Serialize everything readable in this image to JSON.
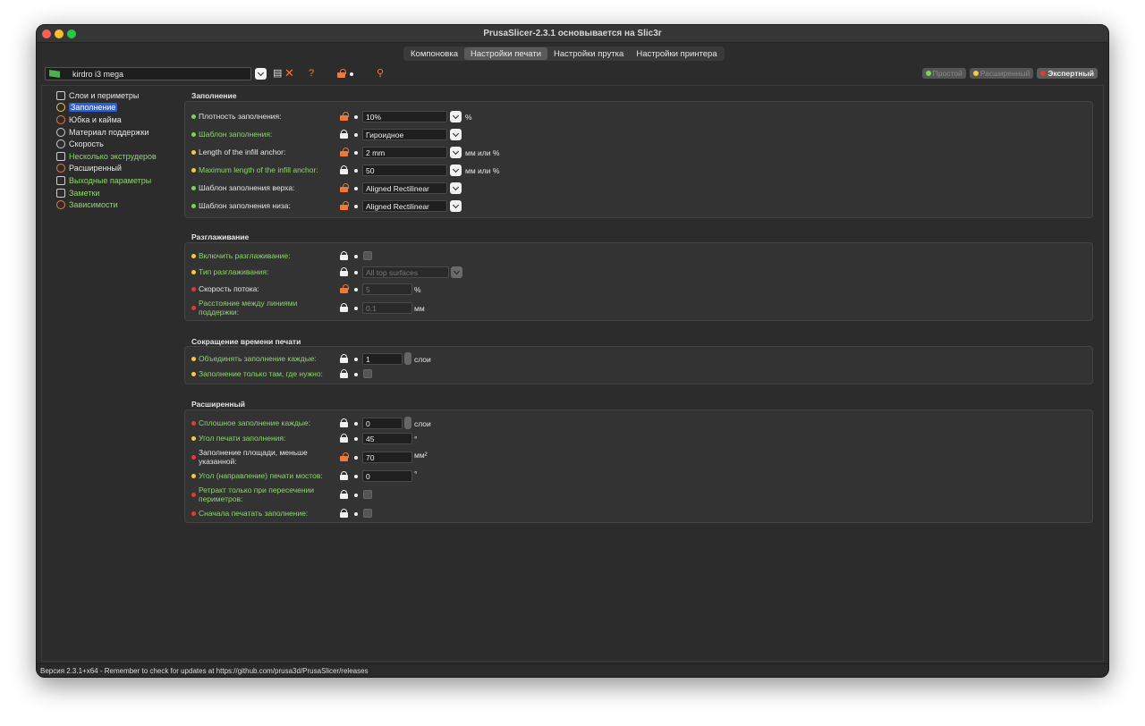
{
  "window": {
    "title": "PrusaSlicer-2.3.1 основывается на Slic3r"
  },
  "tabs": [
    {
      "label": "Компоновка"
    },
    {
      "label": "Настройки печати"
    },
    {
      "label": "Настройки прутка"
    },
    {
      "label": "Настройки принтера"
    }
  ],
  "preset": {
    "name": "kirdro i3 mega"
  },
  "modes": {
    "simple": "Простой",
    "advanced": "Расширенный",
    "expert": "Экспертный"
  },
  "sidebar": {
    "items": [
      {
        "label": "Слои и периметры"
      },
      {
        "label": "Заполнение"
      },
      {
        "label": "Юбка и кайма"
      },
      {
        "label": "Материал поддержки"
      },
      {
        "label": "Скорость"
      },
      {
        "label": "Несколько экструдеров"
      },
      {
        "label": "Расширенный"
      },
      {
        "label": "Выходные параметры"
      },
      {
        "label": "Заметки"
      },
      {
        "label": "Зависимости"
      }
    ]
  },
  "sections": {
    "infill": {
      "title": "Заполнение",
      "rows": [
        {
          "label": "Плотность заполнения:",
          "value": "10%",
          "unit": "%"
        },
        {
          "label": "Шаблон заполнения:",
          "value": "Гироидное"
        },
        {
          "label": "Length of the infill anchor:",
          "value": "2 mm",
          "unit": "мм или %"
        },
        {
          "label": "Maximum length of the infill anchor:",
          "value": "50",
          "unit": "мм или %"
        },
        {
          "label": "Шаблон заполнения верха:",
          "value": "Aligned Rectilinear"
        },
        {
          "label": "Шаблон заполнения низа:",
          "value": "Aligned Rectilinear"
        }
      ]
    },
    "ironing": {
      "title": "Разглаживание",
      "rows": [
        {
          "label": "Включить разглаживание:"
        },
        {
          "label": "Тип разглаживания:",
          "value": "All top surfaces"
        },
        {
          "label": "Скорость потока:",
          "value": "5",
          "unit": "%"
        },
        {
          "label": "Расстояние между линиями поддержки:",
          "value": "0.1",
          "unit": "мм"
        }
      ]
    },
    "reducing": {
      "title": "Сокращение времени печати",
      "rows": [
        {
          "label": "Объединять заполнение каждые:",
          "value": "1",
          "unit": "слои"
        },
        {
          "label": "Заполнение только там, где нужно:"
        }
      ]
    },
    "advanced": {
      "title": "Расширенный",
      "rows": [
        {
          "label": "Сплошное заполнение каждые:",
          "value": "0",
          "unit": "слои"
        },
        {
          "label": "Угол печати заполнения:",
          "value": "45",
          "unit": "°"
        },
        {
          "label": "Заполнение площади, меньше указанной:",
          "value": "70",
          "unit": "мм²"
        },
        {
          "label": "Угол (направление) печати мостов:",
          "value": "0",
          "unit": "°"
        },
        {
          "label": "Ретракт только при пересечении периметров:"
        },
        {
          "label": "Сначала печатать заполнение:"
        }
      ]
    }
  },
  "statusbar": {
    "text": "Версия 2.3.1+x64 - Remember to check for updates at https://github.com/prusa3d/PrusaSlicer/releases"
  },
  "colors": {
    "accent": "#2b5fd9",
    "lock_open": "#f07838",
    "green_label": "#8fd46f",
    "dot_green": "#7fd157",
    "dot_yellow": "#f6c945",
    "dot_red": "#e03b3b"
  }
}
